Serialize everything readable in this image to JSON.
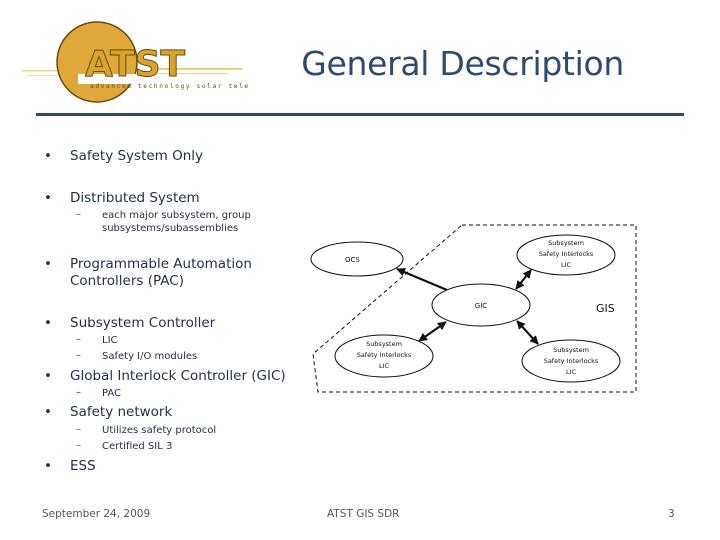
{
  "logo": {
    "wordmark": "ATST",
    "tagline": "advanced technology solar telescope",
    "colors": {
      "sun": "#e0a83a",
      "letters": "#c8941e",
      "outline": "#6b4a12",
      "streak": "#efd58a"
    }
  },
  "title": "General Description",
  "colors": {
    "title": "#2d4a72",
    "rule": "#2b4a6f",
    "body_text": "#1f2f47",
    "footer_text": "#555555"
  },
  "bullets": [
    {
      "text": "Safety System Only",
      "sub": []
    },
    {
      "text": "Distributed System",
      "sub": [
        "each major subsystem, group subsystems/subassemblies"
      ]
    },
    {
      "text": "Programmable Automation Controllers (PAC)",
      "sub": []
    },
    {
      "text": "Subsystem Controller",
      "sub": [
        "LIC",
        "Safety I/O modules"
      ]
    },
    {
      "text": "Global Interlock Controller (GIC)",
      "sub": [
        "PAC"
      ]
    },
    {
      "text": "Safety network",
      "sub": [
        "Utilizes safety protocol",
        "Certified SIL 3"
      ]
    },
    {
      "text": "ESS",
      "sub": []
    }
  ],
  "bullet_text": {
    "b0": "Safety System Only",
    "b1": "Distributed System",
    "b1s0a": "each major subsystem, group",
    "b1s0b": "subsystems/subassemblies",
    "b2a": "Programmable Automation",
    "b2b": "Controllers (PAC)",
    "b3": "Subsystem Controller",
    "b3s0": "LIC",
    "b3s1": "Safety I/O modules",
    "b4": "Global Interlock Controller (GIC)",
    "b4s0": "PAC",
    "b5": "Safety network",
    "b5s0": "Utilizes safety protocol",
    "b5s1": "Certified SIL 3",
    "b6": "ESS",
    "bullet_glyph": "•",
    "dash_glyph": "–"
  },
  "diagram": {
    "boundary_label": "GIS",
    "nodes": {
      "ocs": {
        "label": "OCS"
      },
      "gic": {
        "label": "GIC"
      },
      "lic_top_right": {
        "lines": [
          "Subsystem",
          "Safety Interlocks",
          "LIC"
        ]
      },
      "lic_bottom_left": {
        "lines": [
          "Subsystem",
          "Safety Interlocks",
          "LIC"
        ]
      },
      "lic_bottom_right": {
        "lines": [
          "Subsystem",
          "Safety Interlocks",
          "LIC"
        ]
      }
    },
    "edges": [
      {
        "from": "gic",
        "to": "ocs",
        "direction": "to"
      },
      {
        "from": "gic",
        "to": "lic_top_right",
        "direction": "both"
      },
      {
        "from": "gic",
        "to": "lic_bottom_left",
        "direction": "both"
      },
      {
        "from": "gic",
        "to": "lic_bottom_right",
        "direction": "both"
      }
    ]
  },
  "footer": {
    "date": "September 24, 2009",
    "center": "ATST GIS SDR",
    "page": "3"
  }
}
